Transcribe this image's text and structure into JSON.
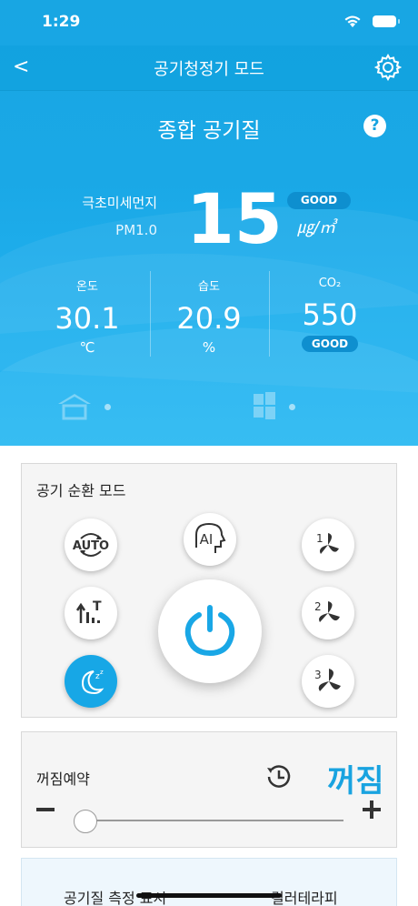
{
  "status_bar": {
    "time": "1:29"
  },
  "nav": {
    "title": "공기청정기 모드",
    "back": "<"
  },
  "overall": {
    "title": "종합 공기질",
    "help": "?",
    "pm_label": "극초미세먼지",
    "pm_sub": "PM1.0",
    "pm_value": "15",
    "pm_badge": "GOOD",
    "pm_unit": "㎍/㎥"
  },
  "metrics": [
    {
      "label": "온도",
      "value": "30.1",
      "unit": "℃"
    },
    {
      "label": "습도",
      "value": "20.9",
      "unit": "%"
    },
    {
      "label": "CO₂",
      "value": "550",
      "badge": "GOOD"
    }
  ],
  "mode_panel": {
    "title": "공기 순환 모드",
    "modes": [
      {
        "name": "auto",
        "label": "AUTO"
      },
      {
        "name": "ai",
        "label": "AI"
      },
      {
        "name": "fan-1",
        "label": "1"
      },
      {
        "name": "turbo",
        "label": "T"
      },
      {
        "name": "fan-2",
        "label": "2"
      },
      {
        "name": "sleep",
        "label": "z"
      },
      {
        "name": "fan-3",
        "label": "3"
      }
    ],
    "active_mode": "sleep"
  },
  "timer": {
    "label": "꺼짐예약",
    "status": "꺼짐",
    "minus": "−",
    "plus": "+"
  },
  "bottom": {
    "left_label": "공기질 측정 표시",
    "right_label": "컬러테라피"
  },
  "colors": {
    "primary": "#17a7e6",
    "badge": "#0e8fcf"
  }
}
